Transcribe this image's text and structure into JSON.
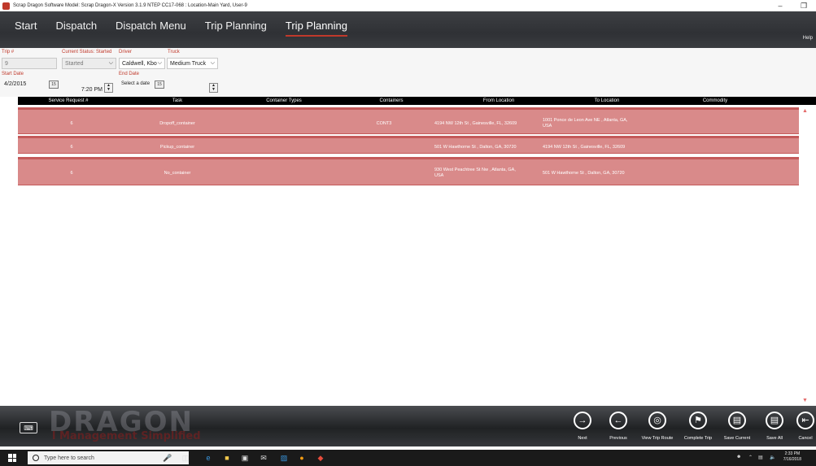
{
  "window": {
    "title": "Scrap Dragon Software Model: Scrap Dragon-X Version 3.1.9 NTEP CC17-068 : Location-Main Yard, User-9",
    "minimize": "–",
    "restore": "❐"
  },
  "nav": {
    "items": [
      "Start",
      "Dispatch",
      "Dispatch Menu",
      "Trip Planning",
      "Trip Planning"
    ],
    "help": "Help"
  },
  "form": {
    "trip_label": "Trip #",
    "trip_value": "9",
    "status_label": "Current Status: Started",
    "status_value": "Started",
    "driver_label": "Driver",
    "driver_value": "Caldwell, Kbo",
    "truck_label": "Truck",
    "truck_value": "Medium Truck",
    "start_date_label": "Start Date",
    "start_date_value": "4/2/2015",
    "start_time_value": "7:20 PM",
    "end_date_label": "End Date",
    "end_date_placeholder": "Select a date",
    "calendar_glyph": "15"
  },
  "table": {
    "headers": [
      "Service Request #",
      "Task",
      "Container Types",
      "Containers",
      "From Location",
      "To Location",
      "Commodity"
    ],
    "rows": [
      {
        "service_request": "6",
        "task": "Dropoff_container",
        "container_types": "",
        "containers": "CONT3",
        "from_location": "4194 NW 12th St , Gainesville, FL, 32609",
        "to_location_1": "1001 Ponce de Leon Ave NE , Atlanta, GA,",
        "to_location_2": "USA",
        "commodity": ""
      },
      {
        "service_request": "6",
        "task": "Pickup_container",
        "container_types": "",
        "containers": "",
        "from_location": "501 W Hawthorne St , Dalton, GA, 30720",
        "to_location_1": "4194 NW 12th St , Gainesville, FL, 32609",
        "to_location_2": "",
        "commodity": ""
      },
      {
        "service_request": "6",
        "task": "No_container",
        "container_types": "",
        "containers": "",
        "from_location_1": "930 West Peachtree St Nw , Atlanta, GA,",
        "from_location_2": "USA",
        "to_location_1": "501 W Hawthorne St , Dalton, GA, 30720",
        "commodity": ""
      }
    ]
  },
  "branding": {
    "logo": "DRAGON",
    "tagline": "l Management Simplified"
  },
  "actions": [
    {
      "label": "Next",
      "icon": "arrow-right-icon"
    },
    {
      "label": "Previous",
      "icon": "arrow-left-icon"
    },
    {
      "label": "View Trip Route",
      "icon": "globe-icon"
    },
    {
      "label": "Complete Trip",
      "icon": "flag-icon"
    },
    {
      "label": "Save Current",
      "icon": "save-icon"
    },
    {
      "label": "Save All",
      "icon": "save-all-icon"
    },
    {
      "label": "Cancel",
      "icon": "cancel-icon"
    }
  ],
  "taskbar": {
    "search_placeholder": "Type here to search",
    "time": "2:33 PM",
    "date": "7/16/2018"
  }
}
